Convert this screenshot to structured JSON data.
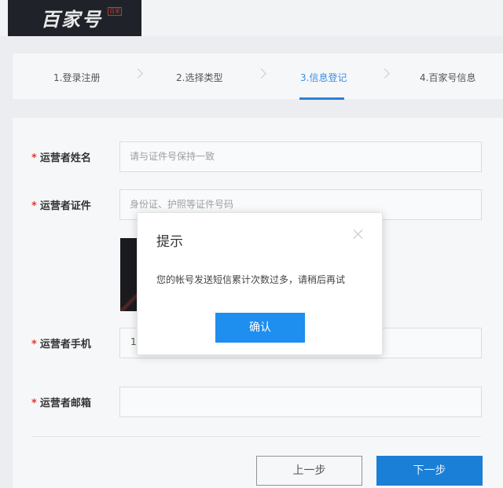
{
  "brand": {
    "logo_text": "百家号",
    "logo_seal": "百家"
  },
  "steps": [
    {
      "label": "1.登录注册"
    },
    {
      "label": "2.选择类型"
    },
    {
      "label": "3.信息登记"
    },
    {
      "label": "4.百家号信息"
    }
  ],
  "active_step_index": 2,
  "form": {
    "required_mark": "*",
    "name_label": "运营者姓名",
    "name_placeholder": "请与证件号保持一致",
    "id_label": "运营者证件",
    "id_placeholder": "身份证、护照等证件号码",
    "phone_label": "运营者手机",
    "phone_value_visible": "1",
    "email_label": "运营者邮箱",
    "email_placeholder": ""
  },
  "actions": {
    "prev_label": "上一步",
    "next_label": "下一步"
  },
  "dialog": {
    "title": "提示",
    "message": "您的帐号发送短信累计次数过多，请稍后再试",
    "confirm_label": "确认"
  },
  "colors": {
    "accent": "#1e8eef",
    "required": "#e53935",
    "active_step": "#3a8ee6"
  }
}
